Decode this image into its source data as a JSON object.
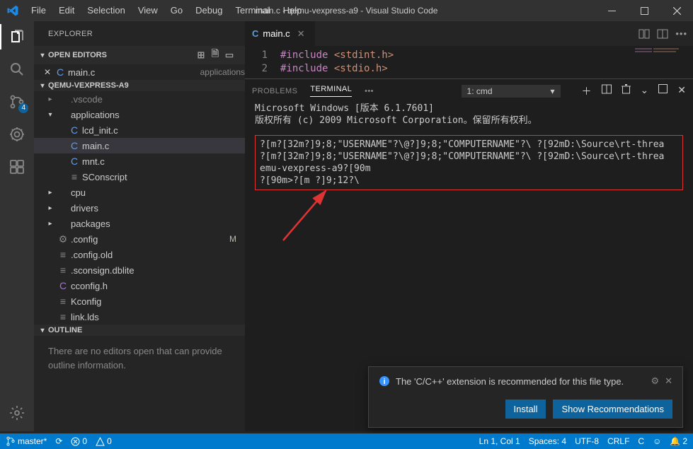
{
  "titlebar": {
    "menus": [
      "File",
      "Edit",
      "Selection",
      "View",
      "Go",
      "Debug",
      "Terminal",
      "Help"
    ],
    "title": "main.c - qemu-vexpress-a9 - Visual Studio Code"
  },
  "activity": {
    "scm_badge": "4"
  },
  "explorer": {
    "title": "EXPLORER",
    "open_editors": "OPEN EDITORS",
    "editor_item": {
      "name": "main.c",
      "sub": "applications"
    },
    "project": "QEMU-VEXPRESS-A9",
    "outline": "OUTLINE",
    "outline_msg": "There are no editors open that can provide outline information.",
    "tree": [
      {
        "dim": true,
        "depth": 1,
        "chev": "▸",
        "icon": "",
        "label": ".vscode"
      },
      {
        "dim": false,
        "depth": 1,
        "chev": "▾",
        "icon": "",
        "label": "applications"
      },
      {
        "dim": false,
        "depth": 2,
        "chev": "",
        "icon": "C",
        "iclass": "cblue",
        "label": "lcd_init.c"
      },
      {
        "dim": false,
        "depth": 2,
        "chev": "",
        "icon": "C",
        "iclass": "cblue",
        "label": "main.c",
        "sel": true
      },
      {
        "dim": false,
        "depth": 2,
        "chev": "",
        "icon": "C",
        "iclass": "cblue",
        "label": "mnt.c"
      },
      {
        "dim": false,
        "depth": 2,
        "chev": "",
        "icon": "≡",
        "iclass": "cgear",
        "label": "SConscript"
      },
      {
        "dim": false,
        "depth": 1,
        "chev": "▸",
        "icon": "",
        "label": "cpu"
      },
      {
        "dim": false,
        "depth": 1,
        "chev": "▸",
        "icon": "",
        "label": "drivers"
      },
      {
        "dim": false,
        "depth": 1,
        "chev": "▸",
        "icon": "",
        "label": "packages"
      },
      {
        "dim": false,
        "depth": 1,
        "chev": "",
        "icon": "⚙",
        "iclass": "cgear",
        "label": ".config",
        "mark": "M"
      },
      {
        "dim": false,
        "depth": 1,
        "chev": "",
        "icon": "≡",
        "iclass": "cgear",
        "label": ".config.old"
      },
      {
        "dim": false,
        "depth": 1,
        "chev": "",
        "icon": "≡",
        "iclass": "cgear",
        "label": ".sconsign.dblite"
      },
      {
        "dim": false,
        "depth": 1,
        "chev": "",
        "icon": "C",
        "iclass": "cpurple",
        "label": "cconfig.h"
      },
      {
        "dim": false,
        "depth": 1,
        "chev": "",
        "icon": "≡",
        "iclass": "cgear",
        "label": "Kconfig"
      },
      {
        "dim": false,
        "depth": 1,
        "chev": "",
        "icon": "≡",
        "iclass": "cgear",
        "label": "link.lds"
      }
    ]
  },
  "editor": {
    "tab": {
      "icon": "C",
      "name": "main.c"
    },
    "lines": [
      {
        "n": "1",
        "kw": "#include",
        "inc": "<stdint.h>"
      },
      {
        "n": "2",
        "kw": "#include",
        "inc": "<stdio.h>"
      }
    ]
  },
  "panel": {
    "problems": "PROBLEMS",
    "terminal": "TERMINAL",
    "more": "•••",
    "selector": "1: cmd",
    "term_lines": [
      "Microsoft Windows [版本 6.1.7601]",
      "版权所有 (c) 2009 Microsoft Corporation。保留所有权利。"
    ],
    "red_lines": [
      "?[m?[32m?]9;8;\"USERNAME\"?\\@?]9;8;\"COMPUTERNAME\"?\\ ?[92mD:\\Source\\rt-threa",
      "?[m?[32m?]9;8;\"USERNAME\"?\\@?]9;8;\"COMPUTERNAME\"?\\ ?[92mD:\\Source\\rt-threa",
      "emu-vexpress-a9?[90m",
      "?[90m>?[m ?]9;12?\\"
    ]
  },
  "notification": {
    "msg": "The 'C/C++' extension is recommended for this file type.",
    "install": "Install",
    "show": "Show Recommendations"
  },
  "status": {
    "branch": "master*",
    "sync": "⟳",
    "errors": "0",
    "warnings": "0",
    "lncol": "Ln 1, Col 1",
    "spaces": "Spaces: 4",
    "enc": "UTF-8",
    "eol": "CRLF",
    "lang": "C",
    "bell": "2"
  }
}
